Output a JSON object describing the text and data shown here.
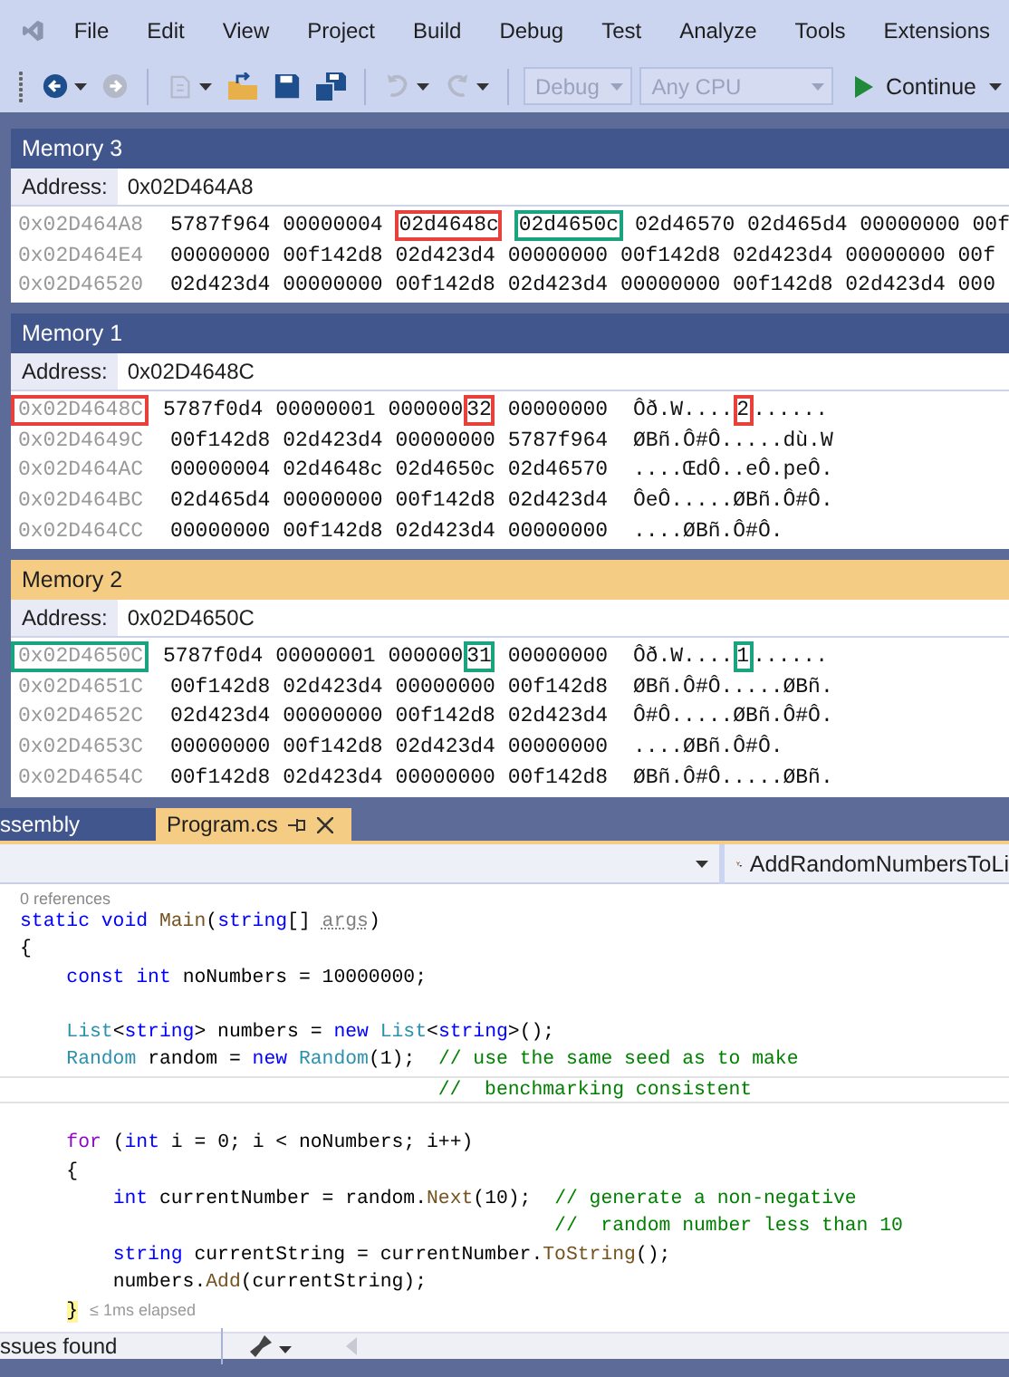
{
  "menu": [
    {
      "label": "File"
    },
    {
      "label": "Edit"
    },
    {
      "label": "View"
    },
    {
      "label": "Project"
    },
    {
      "label": "Build"
    },
    {
      "label": "Debug"
    },
    {
      "label": "Test"
    },
    {
      "label": "Analyze"
    },
    {
      "label": "Tools"
    },
    {
      "label": "Extensions"
    }
  ],
  "toolbar": {
    "buttons": [
      {
        "kind": "back",
        "disabled": false,
        "menu": true
      },
      {
        "kind": "forward",
        "disabled": true,
        "menu": false
      },
      {
        "kind": "separator"
      },
      {
        "kind": "new",
        "disabled": true,
        "menu": true
      },
      {
        "kind": "open",
        "disabled": false,
        "menu": false
      },
      {
        "kind": "save",
        "disabled": false,
        "menu": false
      },
      {
        "kind": "save-all",
        "disabled": false,
        "menu": false
      },
      {
        "kind": "separator"
      },
      {
        "kind": "undo",
        "disabled": true,
        "menu": true
      },
      {
        "kind": "redo",
        "disabled": true,
        "menu": true
      },
      {
        "kind": "separator"
      }
    ],
    "combos": [
      {
        "value": "Debug",
        "disabled": true
      },
      {
        "value": "Any CPU",
        "disabled": true
      }
    ],
    "run": {
      "label": "Continue"
    }
  },
  "memory_windows": [
    {
      "title": "Memory 3",
      "active": false,
      "address_label": "Address:",
      "address": "0x02D464A8",
      "rows": [
        {
          "address": "0x02D464A8",
          "words": [
            "5787f964",
            "00000004",
            {
              "parts": [
                {
                  "text": "02d4648c",
                  "color": "#e8413c"
                }
              ]
            },
            {
              "parts": [
                {
                  "text": "02d4650c",
                  "color": "#1aa37f"
                }
              ]
            },
            "02d46570",
            "02d465d4",
            "00000000",
            "00f"
          ]
        },
        {
          "address": "0x02D464E4",
          "words": [
            "00000000",
            "00f142d8",
            "02d423d4",
            "00000000",
            "00f142d8",
            "02d423d4",
            "00000000",
            "00f"
          ]
        },
        {
          "address": "0x02D46520",
          "words": [
            "02d423d4",
            "00000000",
            "00f142d8",
            "02d423d4",
            "00000000",
            "00f142d8",
            "02d423d4",
            "000"
          ]
        }
      ]
    },
    {
      "title": "Memory 1",
      "active": false,
      "address_label": "Address:",
      "address": "0x02D4648C",
      "rows": [
        {
          "address": {
            "text": "0x02D4648C",
            "color": "#e8413c"
          },
          "words": [
            "5787f0d4",
            "00000001",
            {
              "parts": [
                {
                  "text": "000000"
                },
                {
                  "text": "32",
                  "color": "#e8413c"
                }
              ]
            },
            "00000000"
          ],
          "ascii": [
            {
              "text": "Ôð.W...."
            },
            {
              "text": "2",
              "color": "#e8413c"
            },
            {
              "text": "......"
            }
          ]
        },
        {
          "address": "0x02D4649C",
          "words": [
            "00f142d8",
            "02d423d4",
            "00000000",
            "5787f964"
          ],
          "ascii": "ØBñ.Ô#Ô.....dù.W"
        },
        {
          "address": "0x02D464AC",
          "words": [
            "00000004",
            "02d4648c",
            "02d4650c",
            "02d46570"
          ],
          "ascii": "....ŒdÔ..eÔ.peÔ."
        },
        {
          "address": "0x02D464BC",
          "words": [
            "02d465d4",
            "00000000",
            "00f142d8",
            "02d423d4"
          ],
          "ascii": "ÔeÔ.....ØBñ.Ô#Ô."
        },
        {
          "address": "0x02D464CC",
          "words": [
            "00000000",
            "00f142d8",
            "02d423d4",
            "00000000"
          ],
          "ascii": "....ØBñ.Ô#Ô."
        }
      ]
    },
    {
      "title": "Memory 2",
      "active": true,
      "address_label": "Address:",
      "address": "0x02D4650C",
      "rows": [
        {
          "address": {
            "text": "0x02D4650C",
            "color": "#1aa37f"
          },
          "words": [
            "5787f0d4",
            "00000001",
            {
              "parts": [
                {
                  "text": "000000"
                },
                {
                  "text": "31",
                  "color": "#1aa37f"
                }
              ]
            },
            "00000000"
          ],
          "ascii": [
            {
              "text": "Ôð.W...."
            },
            {
              "text": "1",
              "color": "#1aa37f"
            },
            {
              "text": "......"
            }
          ]
        },
        {
          "address": "0x02D4651C",
          "words": [
            "00f142d8",
            "02d423d4",
            "00000000",
            "00f142d8"
          ],
          "ascii": "ØBñ.Ô#Ô.....ØBñ."
        },
        {
          "address": "0x02D4652C",
          "words": [
            "02d423d4",
            "00000000",
            "00f142d8",
            "02d423d4"
          ],
          "ascii": "Ô#Ô.....ØBñ.Ô#Ô."
        },
        {
          "address": "0x02D4653C",
          "words": [
            "00000000",
            "00f142d8",
            "02d423d4",
            "00000000"
          ],
          "ascii": "....ØBñ.Ô#Ô."
        },
        {
          "address": "0x02D4654C",
          "words": [
            "00f142d8",
            "02d423d4",
            "00000000",
            "00f142d8"
          ],
          "ascii": "ØBñ.Ô#Ô.....ØBñ."
        }
      ]
    }
  ],
  "editor_tabs": [
    {
      "label": "ssembly",
      "selected": false
    },
    {
      "label": "Program.cs",
      "selected": true
    }
  ],
  "navigation": {
    "member": "AddRandomNumbersToLi"
  },
  "code_lines": [
    {
      "kind": "codelens",
      "text": "0 references"
    },
    {
      "kind": "code",
      "tokens": [
        {
          "text": "static void",
          "kind": "keyword"
        },
        {
          "text": " Main",
          "kind": "method"
        },
        {
          "text": "(",
          "kind": "plain"
        },
        {
          "text": "string",
          "kind": "keyword"
        },
        {
          "text": "[] ",
          "kind": "plain"
        },
        {
          "text": "args",
          "kind": "unused"
        },
        {
          "text": ")",
          "kind": "plain"
        }
      ]
    },
    {
      "kind": "code",
      "tokens": [
        {
          "text": "{",
          "kind": "plain"
        }
      ]
    },
    {
      "kind": "code",
      "tokens": [
        {
          "text": "    const int",
          "kind": "keyword"
        },
        {
          "text": " noNumbers = 10000000;",
          "kind": "plain"
        }
      ]
    },
    {
      "kind": "blank"
    },
    {
      "kind": "code",
      "tokens": [
        {
          "text": "    List",
          "kind": "type"
        },
        {
          "text": "<",
          "kind": "plain"
        },
        {
          "text": "string",
          "kind": "keyword"
        },
        {
          "text": "> numbers = ",
          "kind": "plain"
        },
        {
          "text": "new",
          "kind": "keyword"
        },
        {
          "text": " List",
          "kind": "type"
        },
        {
          "text": "<",
          "kind": "plain"
        },
        {
          "text": "string",
          "kind": "keyword"
        },
        {
          "text": ">();",
          "kind": "plain"
        }
      ]
    },
    {
      "kind": "code",
      "tokens": [
        {
          "text": "    Random",
          "kind": "type"
        },
        {
          "text": " random = ",
          "kind": "plain"
        },
        {
          "text": "new",
          "kind": "keyword"
        },
        {
          "text": " Random",
          "kind": "type"
        },
        {
          "text": "(1);",
          "kind": "plain"
        },
        {
          "text": "  // use the same seed as to make",
          "kind": "comment"
        }
      ]
    },
    {
      "kind": "code",
      "current": true,
      "tokens": [
        {
          "text": "                                    //  benchmarking consistent",
          "kind": "comment"
        }
      ]
    },
    {
      "kind": "blank"
    },
    {
      "kind": "code",
      "tokens": [
        {
          "text": "    for",
          "kind": "control"
        },
        {
          "text": " (",
          "kind": "plain"
        },
        {
          "text": "int",
          "kind": "keyword"
        },
        {
          "text": " i = 0; i < noNumbers; i++)",
          "kind": "plain"
        }
      ]
    },
    {
      "kind": "code",
      "tokens": [
        {
          "text": "    {",
          "kind": "plain"
        }
      ]
    },
    {
      "kind": "code",
      "tokens": [
        {
          "text": "        int",
          "kind": "keyword"
        },
        {
          "text": " currentNumber = random.",
          "kind": "plain"
        },
        {
          "text": "Next",
          "kind": "method"
        },
        {
          "text": "(10);",
          "kind": "plain"
        },
        {
          "text": "  // generate a non-negative",
          "kind": "comment"
        }
      ]
    },
    {
      "kind": "code",
      "tokens": [
        {
          "text": "                                              //  random number less than 10",
          "kind": "comment"
        }
      ]
    },
    {
      "kind": "code",
      "tokens": [
        {
          "text": "        string",
          "kind": "keyword"
        },
        {
          "text": " currentString = currentNumber.",
          "kind": "plain"
        },
        {
          "text": "ToString",
          "kind": "method"
        },
        {
          "text": "();",
          "kind": "plain"
        }
      ]
    },
    {
      "kind": "code",
      "tokens": [
        {
          "text": "        numbers.",
          "kind": "plain"
        },
        {
          "text": "Add",
          "kind": "method"
        },
        {
          "text": "(currentString);",
          "kind": "plain"
        }
      ]
    },
    {
      "kind": "code",
      "tokens": [
        {
          "text": "    }",
          "kind": "brace-match"
        },
        {
          "text": " ≤ 1ms elapsed",
          "kind": "hint"
        }
      ]
    }
  ],
  "status_bar": {
    "issues": "ssues found"
  }
}
